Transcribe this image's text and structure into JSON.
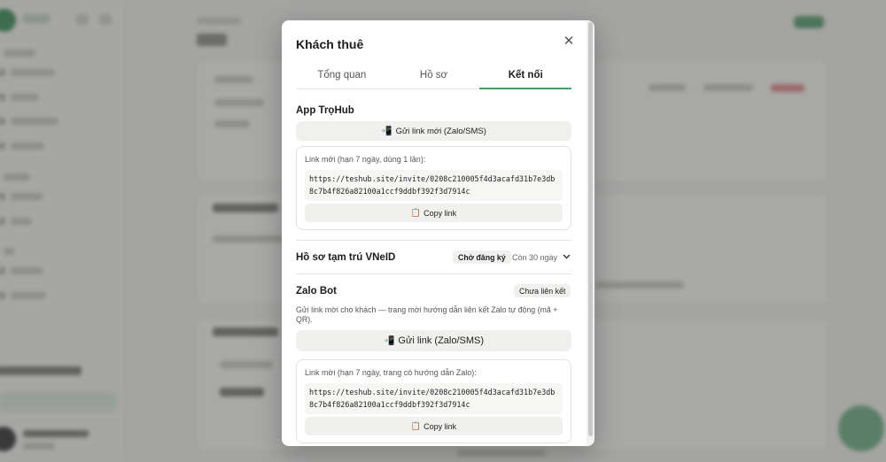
{
  "modal": {
    "title": "Khách thuê",
    "tabs": [
      {
        "label": "Tổng quan",
        "active": false
      },
      {
        "label": "Hồ sơ",
        "active": false
      },
      {
        "label": "Kết nối",
        "active": true
      }
    ]
  },
  "app_section": {
    "title": "App TrọHub",
    "send_button": "Gửi link mới (Zalo/SMS)",
    "link_caption": "Link mới (hạn 7 ngày, dùng 1 lần):",
    "link_url": "https://teshub.site/invite/0208c210005f4d3acafd31b7e3db8c7b4f826a82100a1ccf9ddbf392f3d7914c",
    "copy_button": "Copy link"
  },
  "vneid_section": {
    "title": "Hồ sơ tạm trú VNeID",
    "status_badge": "Chờ đăng ký",
    "remaining": "Còn 30 ngày"
  },
  "zalo_section": {
    "title": "Zalo Bot",
    "status_badge": "Chưa liên kết",
    "description": "Gửi link mời cho khách — trang mời hướng dẫn liên kết Zalo tự động (mã + QR).",
    "send_button": "Gửi link (Zalo/SMS)",
    "link_caption": "Link mời (hạn 7 ngày, trang có hướng dẫn Zalo):",
    "link_url": "https://teshub.site/invite/0208c210005f4d3acafd31b7e3db8c7b4f826a82100a1ccf9ddbf392f3d7914c",
    "copy_button": "Copy link"
  },
  "icons": {
    "close": "close-icon",
    "phone": "mobile-arrow-icon",
    "clipboard": "clipboard-icon",
    "chevron": "chevron-down-icon"
  },
  "colors": {
    "accent": "#4f9a6a",
    "overlay": "rgba(35,35,35,0.38)"
  }
}
